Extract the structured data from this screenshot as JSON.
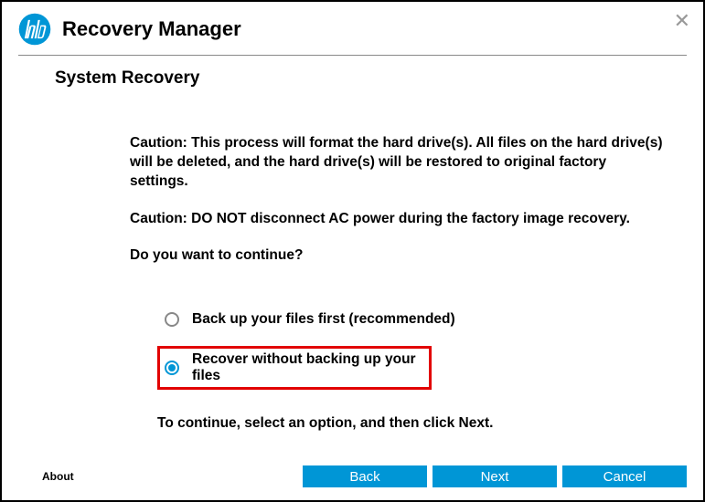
{
  "header": {
    "title": "Recovery Manager"
  },
  "subtitle": "System Recovery",
  "content": {
    "caution1": "Caution: This process will format the hard drive(s). All files on the hard drive(s) will be deleted, and the hard drive(s) will be restored to original factory settings.",
    "caution2": "Caution: DO NOT disconnect AC power during the factory image recovery.",
    "question": "Do you want to continue?",
    "options": [
      {
        "label": "Back up your files first (recommended)",
        "selected": false,
        "highlighted": false
      },
      {
        "label": "Recover without backing up your files",
        "selected": true,
        "highlighted": true
      }
    ],
    "instruction": "To continue, select an option, and then click Next."
  },
  "footer": {
    "about": "About",
    "buttons": {
      "back": "Back",
      "next": "Next",
      "cancel": "Cancel"
    }
  }
}
